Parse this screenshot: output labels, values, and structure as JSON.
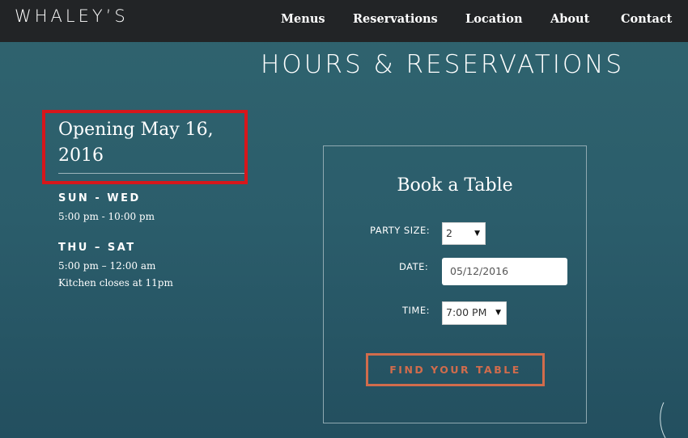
{
  "header": {
    "logo": "WHALEY’S",
    "nav": [
      "Menus",
      "Reservations",
      "Location",
      "About",
      "Contact"
    ]
  },
  "page": {
    "title": "HOURS & RESERVATIONS"
  },
  "hours": {
    "opening_line1": "Opening May 16,",
    "opening_line2": "2016",
    "blocks": [
      {
        "days": "SUN - WED",
        "lines": [
          "5:00 pm - 10:00 pm"
        ]
      },
      {
        "days": "THU – SAT",
        "lines": [
          "5:00 pm – 12:00 am",
          "Kitchen closes at 11pm"
        ]
      }
    ]
  },
  "booking": {
    "title": "Book a Table",
    "party_size_label": "PARTY SIZE:",
    "party_size_value": "2",
    "date_label": "DATE:",
    "date_value": "05/12/2016",
    "time_label": "TIME:",
    "time_value": "7:00 PM",
    "submit_label": "FIND YOUR TABLE"
  },
  "colors": {
    "topbar": "#222426",
    "background": "#2b5d6b",
    "highlight": "#d7161b",
    "button_accent": "#d16c4c"
  }
}
